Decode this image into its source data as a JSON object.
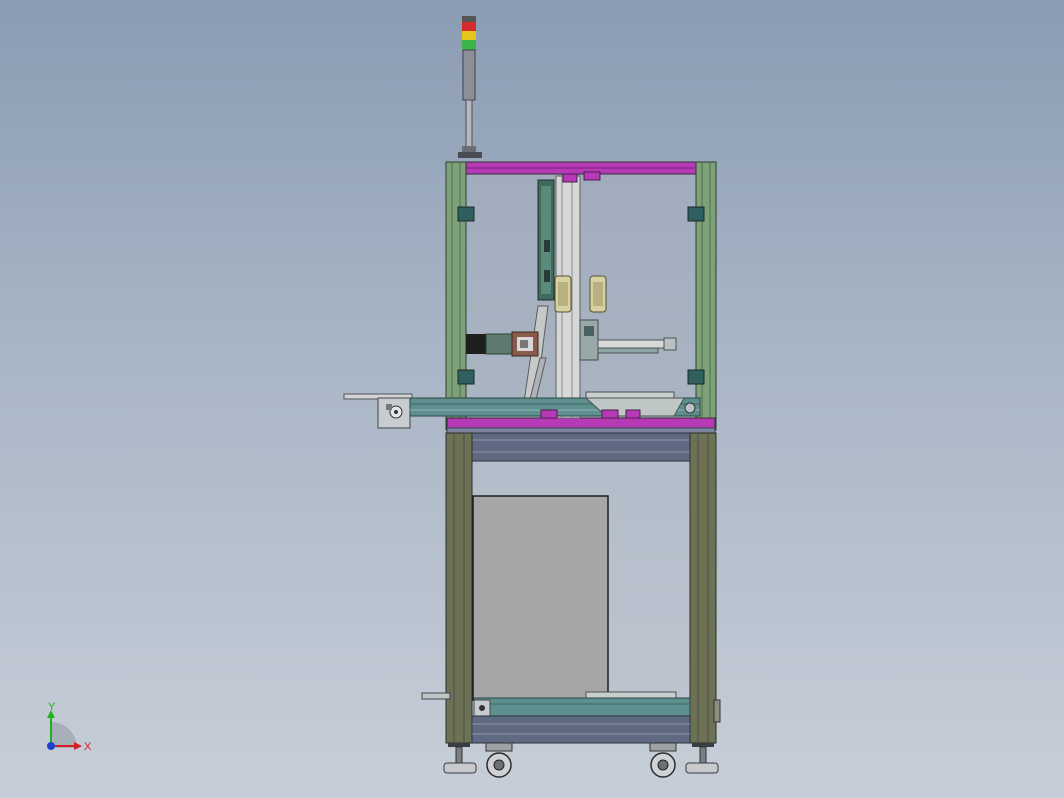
{
  "viewport": {
    "background_top": "#8a9cb3",
    "background_bottom": "#c7ced8"
  },
  "colors": {
    "frame_green": "#7fa17a",
    "frame_green_dark": "#4e6e4a",
    "frame_magenta": "#b63ab6",
    "frame_olive": "#6d7257",
    "frame_slate": "#5f6a82",
    "panel_gray": "#a6a6a8",
    "teal_rail": "#5e8f8f",
    "light_steel": "#c9cccc",
    "tower_red": "#d62b2b",
    "tower_yellow": "#e3c51c",
    "tower_green": "#39b54a"
  },
  "triad": {
    "x_label": "X",
    "y_label": "Y",
    "x_color": "#d42020",
    "y_color": "#20b020",
    "z_color": "#2040d0"
  }
}
